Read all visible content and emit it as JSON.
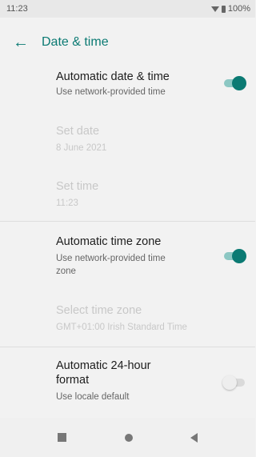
{
  "status_bar": {
    "time": "11:23",
    "battery": "100%",
    "wifi_icon": "wifi-icon",
    "battery_icon": "battery-icon"
  },
  "app_bar": {
    "title": "Date & time",
    "back_icon": "arrow-back-icon",
    "accent_color": "#0b7a73"
  },
  "settings": {
    "auto_date_time": {
      "title": "Automatic date & time",
      "subtitle": "Use network-provided time",
      "enabled": true
    },
    "set_date": {
      "title": "Set date",
      "value": "8 June 2021",
      "disabled": true
    },
    "set_time": {
      "title": "Set time",
      "value": "11:23",
      "disabled": true
    },
    "auto_time_zone": {
      "title": "Automatic time zone",
      "subtitle_line1": "Use network-provided time",
      "subtitle_line2": "zone",
      "enabled": true
    },
    "select_time_zone": {
      "title": "Select time zone",
      "value": "GMT+01:00 Irish Standard Time",
      "disabled": true
    },
    "auto_24_hour": {
      "title_line1": "Automatic 24-hour",
      "title_line2": "format",
      "subtitle": "Use locale default",
      "enabled": false
    }
  },
  "nav_bar": {
    "recents_icon": "recents-square-icon",
    "home_icon": "home-circle-icon",
    "back_icon": "back-triangle-icon"
  }
}
